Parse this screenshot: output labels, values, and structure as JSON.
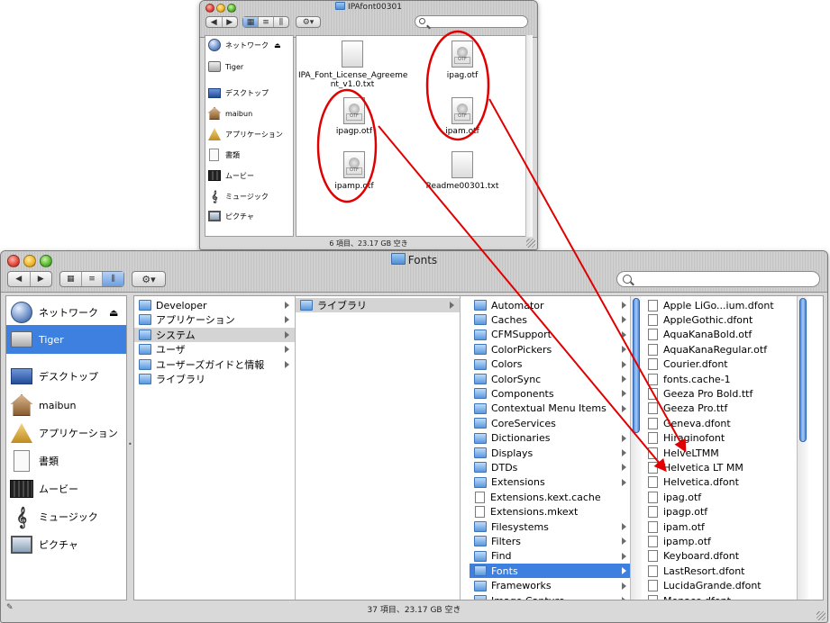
{
  "top_window": {
    "title": "IPAfont00301",
    "sidebar": [
      {
        "label": "ネットワーク"
      },
      {
        "label": "Tiger"
      },
      {
        "label": "デスクトップ"
      },
      {
        "label": "maibun"
      },
      {
        "label": "アプリケーション"
      },
      {
        "label": "書類"
      },
      {
        "label": "ムービー"
      },
      {
        "label": "ミュージック"
      },
      {
        "label": "ピクチャ"
      }
    ],
    "files": [
      {
        "label": "IPA_Font_License_Agreeme",
        "label2": "nt_v1.0.txt"
      },
      {
        "label": "ipag.otf"
      },
      {
        "label": "ipagp.otf"
      },
      {
        "label": "ipam.otf"
      },
      {
        "label": "ipamp.otf"
      },
      {
        "label": "Readme00301.txt"
      }
    ],
    "status": "6 項目、23.17 GB 空き"
  },
  "bottom_window": {
    "title": "Fonts",
    "sidebar": [
      {
        "label": "ネットワーク"
      },
      {
        "label": "Tiger"
      },
      {
        "label": "デスクトップ"
      },
      {
        "label": "maibun"
      },
      {
        "label": "アプリケーション"
      },
      {
        "label": "書類"
      },
      {
        "label": "ムービー"
      },
      {
        "label": "ミュージック"
      },
      {
        "label": "ピクチャ"
      }
    ],
    "col1": [
      "Developer",
      "アプリケーション",
      "システム",
      "ユーザ",
      "ユーザーズガイドと情報",
      "ライブラリ"
    ],
    "col2": [
      "ライブラリ"
    ],
    "col3": [
      "Automator",
      "Caches",
      "CFMSupport",
      "ColorPickers",
      "Colors",
      "ColorSync",
      "Components",
      "Contextual Menu Items",
      "CoreServices",
      "Dictionaries",
      "Displays",
      "DTDs",
      "Extensions",
      "Extensions.kext.cache",
      "Extensions.mkext",
      "Filesystems",
      "Filters",
      "Find",
      "Fonts",
      "Frameworks",
      "Image Capture"
    ],
    "col4": [
      "Apple LiGo...ium.dfont",
      "AppleGothic.dfont",
      "AquaKanaBold.otf",
      "AquaKanaRegular.otf",
      "Courier.dfont",
      "fonts.cache-1",
      "Geeza Pro Bold.ttf",
      "Geeza Pro.ttf",
      "Geneva.dfont",
      "Hiraginofont",
      "HelveLTMM",
      "Helvetica LT MM",
      "Helvetica.dfont",
      "ipag.otf",
      "ipagp.otf",
      "ipam.otf",
      "ipamp.otf",
      "Keyboard.dfont",
      "LastResort.dfont",
      "LucidaGrande.dfont",
      "Monaco.dfont"
    ],
    "status": "37 項目、23.17 GB 空き"
  },
  "colors": {
    "selection": "#3d80df",
    "annotation": "#e00000"
  }
}
